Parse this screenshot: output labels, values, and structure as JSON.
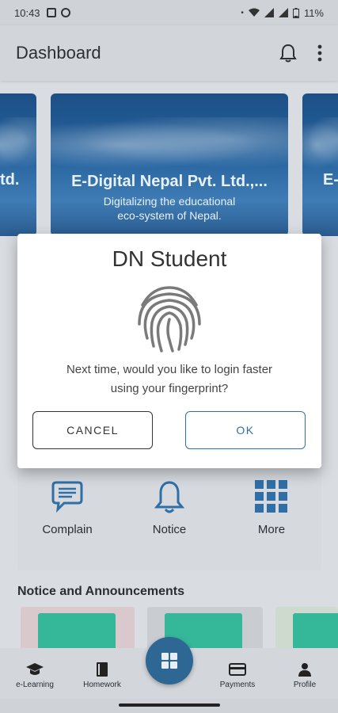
{
  "status": {
    "time": "10:43",
    "battery": "11%"
  },
  "app_bar": {
    "title": "Dashboard",
    "icons": [
      "bell-icon",
      "more-vert-icon"
    ]
  },
  "carousel": {
    "main_title": "E-Digital Nepal Pvt. Ltd.,...",
    "main_subtitle_line1": "Digitalizing the educational",
    "main_subtitle_line2": "eco-system of Nepal.",
    "left_fragment": "td.",
    "right_fragment": "E-"
  },
  "dialog": {
    "title": "DN Student",
    "message_line1": "Next time, would you like to login faster",
    "message_line2": "using your fingerprint?",
    "cancel_label": "CANCEL",
    "ok_label": "OK"
  },
  "quick_actions": [
    {
      "label": "Complain",
      "icon": "chat-icon"
    },
    {
      "label": "Notice",
      "icon": "bell-icon"
    },
    {
      "label": "More",
      "icon": "grid-icon"
    }
  ],
  "notices": {
    "section_title": "Notice and Announcements"
  },
  "bottom_nav": [
    {
      "label": "e-Learning",
      "icon": "graduation-cap-icon"
    },
    {
      "label": "Homework",
      "icon": "book-icon"
    },
    {
      "label": "Payments",
      "icon": "card-icon"
    },
    {
      "label": "Profile",
      "icon": "person-icon"
    }
  ],
  "colors": {
    "accent": "#2f6fa6",
    "fab": "#2e6694"
  }
}
